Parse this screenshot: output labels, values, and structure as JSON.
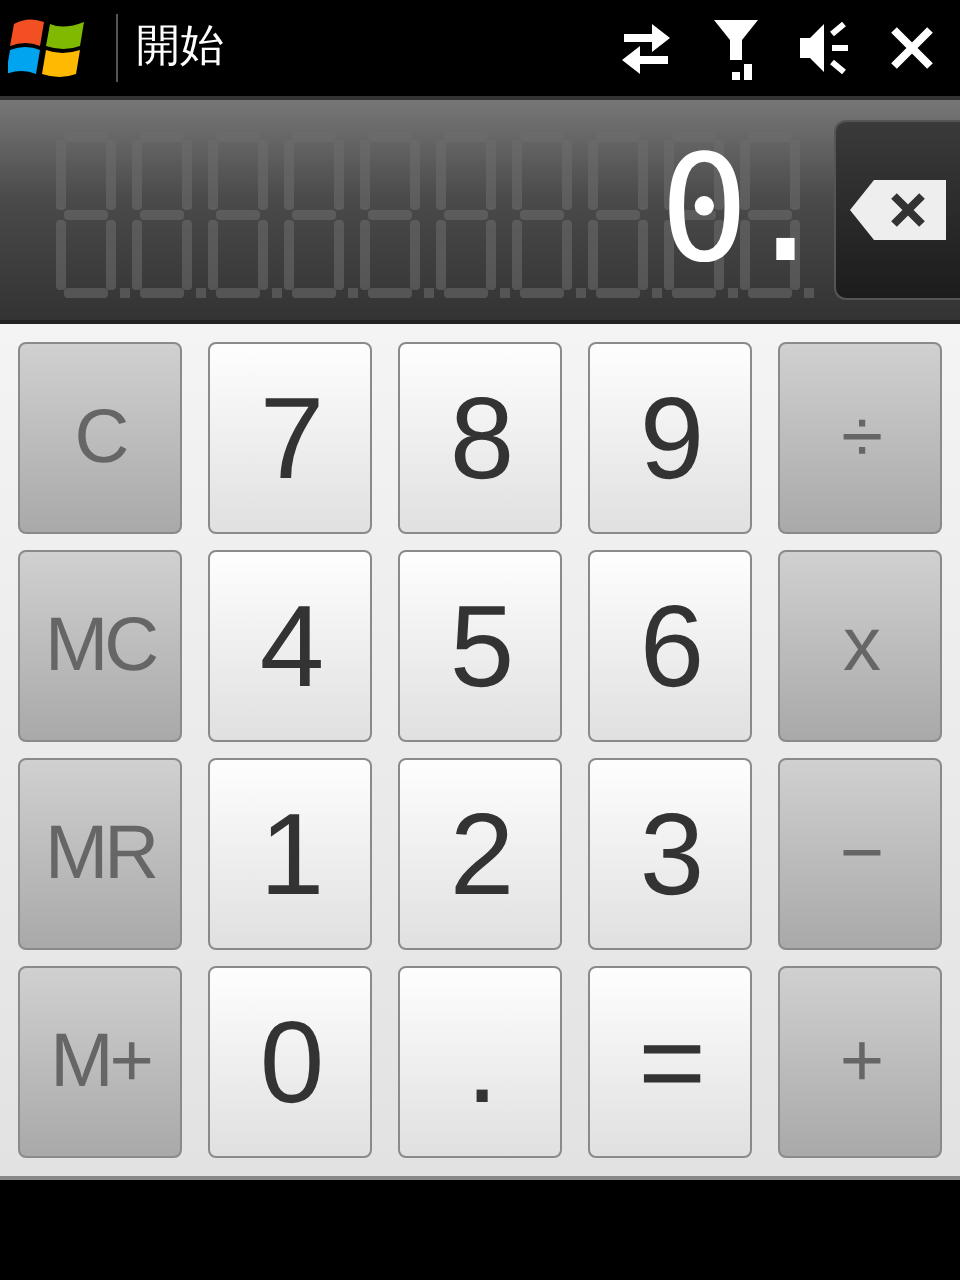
{
  "title_bar": {
    "title": "開始"
  },
  "display": {
    "value": "0."
  },
  "keypad": {
    "rows": [
      [
        {
          "label": "C",
          "kind": "function"
        },
        {
          "label": "7",
          "kind": "digit"
        },
        {
          "label": "8",
          "kind": "digit"
        },
        {
          "label": "9",
          "kind": "digit"
        },
        {
          "label": "÷",
          "kind": "function"
        }
      ],
      [
        {
          "label": "MC",
          "kind": "function"
        },
        {
          "label": "4",
          "kind": "digit"
        },
        {
          "label": "5",
          "kind": "digit"
        },
        {
          "label": "6",
          "kind": "digit"
        },
        {
          "label": "x",
          "kind": "function"
        }
      ],
      [
        {
          "label": "MR",
          "kind": "function"
        },
        {
          "label": "1",
          "kind": "digit"
        },
        {
          "label": "2",
          "kind": "digit"
        },
        {
          "label": "3",
          "kind": "digit"
        },
        {
          "label": "−",
          "kind": "function"
        }
      ],
      [
        {
          "label": "M+",
          "kind": "function"
        },
        {
          "label": "0",
          "kind": "digit"
        },
        {
          "label": ".",
          "kind": "digit"
        },
        {
          "label": "=",
          "kind": "digit"
        },
        {
          "label": "+",
          "kind": "function"
        }
      ]
    ]
  }
}
